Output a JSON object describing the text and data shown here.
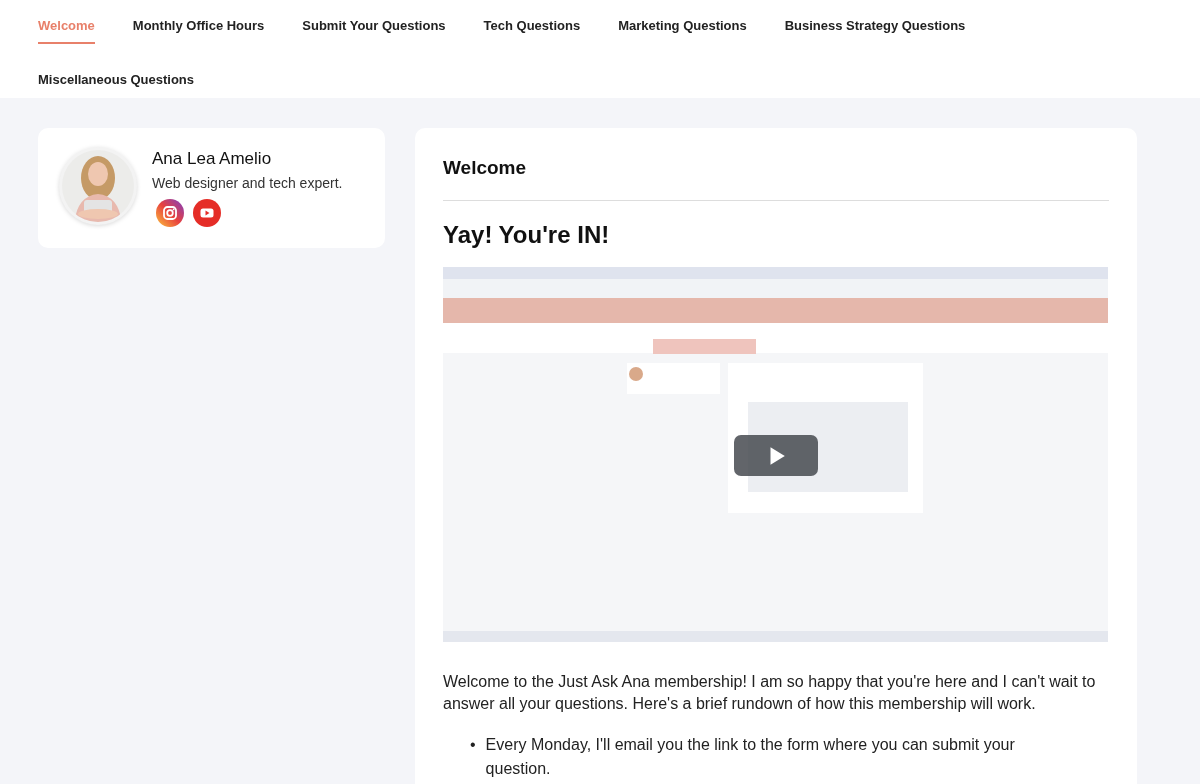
{
  "tabs": [
    {
      "label": "Welcome",
      "selected": true
    },
    {
      "label": "Monthly Office Hours",
      "selected": false
    },
    {
      "label": "Submit Your Questions",
      "selected": false
    },
    {
      "label": "Tech Questions",
      "selected": false
    },
    {
      "label": "Marketing Questions",
      "selected": false
    },
    {
      "label": "Business Strategy Questions",
      "selected": false
    },
    {
      "label": "Miscellaneous Questions",
      "selected": false
    }
  ],
  "profile": {
    "name": "Ana Lea Amelio",
    "bio": "Web designer and tech expert.",
    "socials": [
      {
        "kind": "instagram"
      },
      {
        "kind": "youtube"
      }
    ]
  },
  "content": {
    "title": "Welcome",
    "heading": "Yay! You're IN!",
    "intro": "Welcome to the Just Ask Ana membership! I am so happy that you're here and I can't wait to answer all your questions. Here's a brief rundown of how this membership will work.",
    "bullets": [
      {
        "marker": "•",
        "text": "Every Monday, I'll email you the link to the form where you can submit your question."
      }
    ]
  }
}
